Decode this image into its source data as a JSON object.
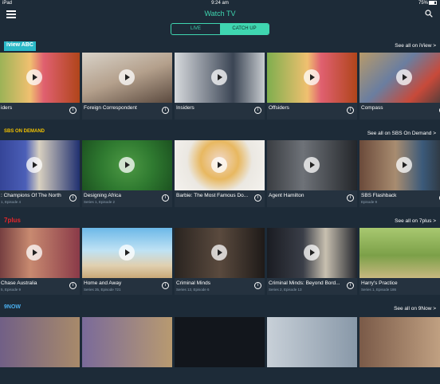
{
  "status": {
    "device": "iPad",
    "time": "9:24 am",
    "battery": "75%"
  },
  "nav": {
    "title": "Watch TV"
  },
  "tabs": [
    {
      "label": "LIVE"
    },
    {
      "label": "CATCH UP"
    }
  ],
  "sections": [
    {
      "provider": "iview ABC",
      "see_all": "See all on iView >",
      "cards": [
        {
          "title": "iders",
          "subtitle": ""
        },
        {
          "title": "Foreign Correspondent",
          "subtitle": ""
        },
        {
          "title": "Insiders",
          "subtitle": ""
        },
        {
          "title": "Offsiders",
          "subtitle": ""
        },
        {
          "title": "Compass",
          "subtitle": ""
        }
      ]
    },
    {
      "provider": "SBS ON DEMAND",
      "see_all": "See all on SBS On Demand >",
      "cards": [
        {
          "title": ": Champions Of The North",
          "subtitle": "1, Episode 4"
        },
        {
          "title": "Designing Africa",
          "subtitle": "Series 1, Episode 2"
        },
        {
          "title": "Barbie: The Most Famous Do...",
          "subtitle": ""
        },
        {
          "title": "Agent Hamilton",
          "subtitle": ""
        },
        {
          "title": "SBS Flashback",
          "subtitle": "Episode 9"
        }
      ]
    },
    {
      "provider": "7plus",
      "see_all": "See all on 7plus >",
      "cards": [
        {
          "title": "Chase Australia",
          "subtitle": "5, Episode 9"
        },
        {
          "title": "Home and Away",
          "subtitle": "Series 35, Episode 721"
        },
        {
          "title": "Criminal Minds",
          "subtitle": "Series 13, Episode 6"
        },
        {
          "title": "Criminal Minds: Beyond Bord...",
          "subtitle": "Series 2, Episode 13"
        },
        {
          "title": "Harry's Practice",
          "subtitle": "Series 1, Episode 186"
        }
      ]
    },
    {
      "provider": "9NOW",
      "see_all": "See all on 9Now >",
      "cards": [
        {
          "title": "",
          "subtitle": ""
        },
        {
          "title": "",
          "subtitle": ""
        },
        {
          "title": "",
          "subtitle": ""
        },
        {
          "title": "",
          "subtitle": ""
        },
        {
          "title": "",
          "subtitle": ""
        }
      ]
    }
  ],
  "colors": {
    "accent": "#3fd6b0",
    "background": "#1d2b38"
  },
  "icons": {
    "menu": "hamburger-icon",
    "search": "search-icon",
    "play": "play-icon",
    "info": "info-icon"
  }
}
